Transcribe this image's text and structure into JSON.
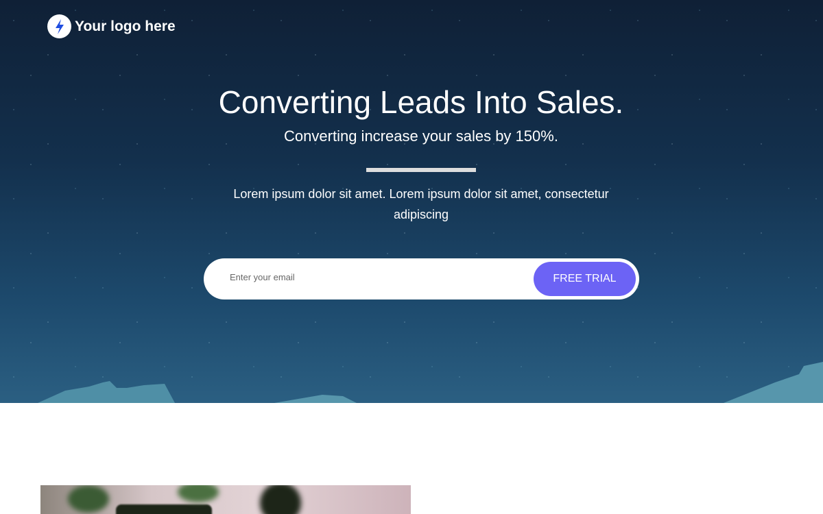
{
  "logo": {
    "text": "Your logo here",
    "icon": "lightning-bolt-icon",
    "icon_color": "#1f4de0"
  },
  "hero": {
    "title": "Converting Leads Into Sales.",
    "subtitle": "Converting increase your sales by 150%.",
    "description": "Lorem ipsum dolor sit amet. Lorem ipsum dolor sit amet, consectetur adipiscing",
    "email_placeholder": "Enter your email",
    "cta_label": "FREE TRIAL",
    "cta_color": "#6c63f5"
  }
}
